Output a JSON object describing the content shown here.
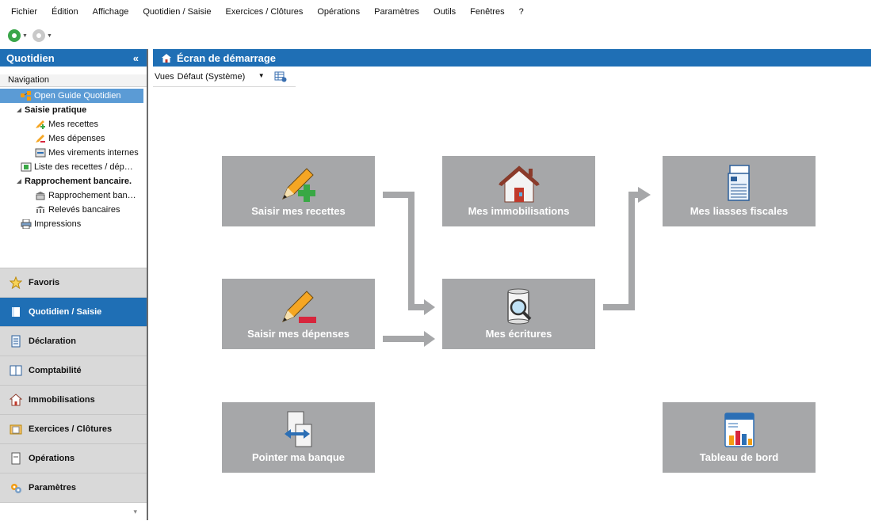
{
  "menu": [
    "Fichier",
    "Édition",
    "Affichage",
    "Quotidien / Saisie",
    "Exercices / Clôtures",
    "Opérations",
    "Paramètres",
    "Outils",
    "Fenêtres",
    "?"
  ],
  "left_panel": {
    "title": "Quotidien",
    "collapse": "«",
    "nav_title": "Navigation",
    "tree": [
      {
        "label": "Open Guide Quotidien",
        "icon": "guide-icon",
        "indent": 1,
        "selected": true
      },
      {
        "label": "Saisie pratique",
        "icon": "expand-icon",
        "indent": 0,
        "group": true
      },
      {
        "label": "Mes recettes",
        "icon": "pencil-plus-icon",
        "indent": 2
      },
      {
        "label": "Mes dépenses",
        "icon": "pencil-minus-icon",
        "indent": 2
      },
      {
        "label": "Mes virements internes",
        "icon": "transfer-icon",
        "indent": 2
      },
      {
        "label": "Liste des recettes / dép…",
        "icon": "list-icon",
        "indent": 1
      },
      {
        "label": "Rapprochement bancaire.",
        "icon": "expand-icon",
        "indent": 0,
        "group": true
      },
      {
        "label": "Rapprochement ban…",
        "icon": "bank-reconcile-icon",
        "indent": 2
      },
      {
        "label": "Relevés bancaires",
        "icon": "bank-icon",
        "indent": 2
      },
      {
        "label": "Impressions",
        "icon": "printer-icon",
        "indent": 1
      }
    ],
    "accordion": [
      {
        "label": "Favoris",
        "icon": "star-icon",
        "active": false
      },
      {
        "label": "Quotidien / Saisie",
        "icon": "book-icon",
        "active": true
      },
      {
        "label": "Déclaration",
        "icon": "form-icon",
        "active": false
      },
      {
        "label": "Comptabilité",
        "icon": "ledger-icon",
        "active": false
      },
      {
        "label": "Immobilisations",
        "icon": "house-icon",
        "active": false
      },
      {
        "label": "Exercices / Clôtures",
        "icon": "folder-icon",
        "active": false
      },
      {
        "label": "Opérations",
        "icon": "operations-icon",
        "active": false
      },
      {
        "label": "Paramètres",
        "icon": "settings-icon",
        "active": false
      }
    ],
    "more": "▾"
  },
  "main": {
    "title": "Écran de démarrage",
    "views_label": "Vues",
    "views_value": "Défaut (Système)",
    "tiles": {
      "recettes": "Saisir mes recettes",
      "immobilisations": "Mes immobilisations",
      "liasses": "Mes liasses fiscales",
      "depenses": "Saisir mes dépenses",
      "ecritures": "Mes écritures",
      "banque": "Pointer ma banque",
      "tableau": "Tableau de bord"
    }
  },
  "colors": {
    "header_blue": "#1f6fb5",
    "tile_gray": "#a6a7a9",
    "arrow_gray": "#a6a7a9"
  }
}
